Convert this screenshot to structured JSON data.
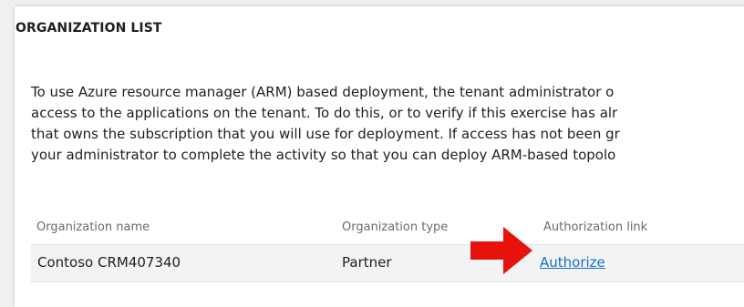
{
  "section": {
    "title": "ORGANIZATION LIST",
    "description_lines": [
      "To use Azure resource manager (ARM) based deployment, the tenant administrator o",
      "access to the applications on the tenant. To do this, or to verify if this exercise has alr",
      "that owns the subscription that you will use for deployment. If access has not been gr",
      "your administrator to complete the activity so that you can deploy ARM-based topolo"
    ]
  },
  "table": {
    "columns": [
      "Organization name",
      "Organization type",
      "Authorization link"
    ],
    "rows": [
      {
        "name": "Contoso CRM407340",
        "type": "Partner",
        "link_label": "Authorize"
      }
    ]
  },
  "colors": {
    "link": "#1570c9",
    "arrow": "#e8120c"
  },
  "icons": {
    "annotation": "red-arrow-icon"
  }
}
